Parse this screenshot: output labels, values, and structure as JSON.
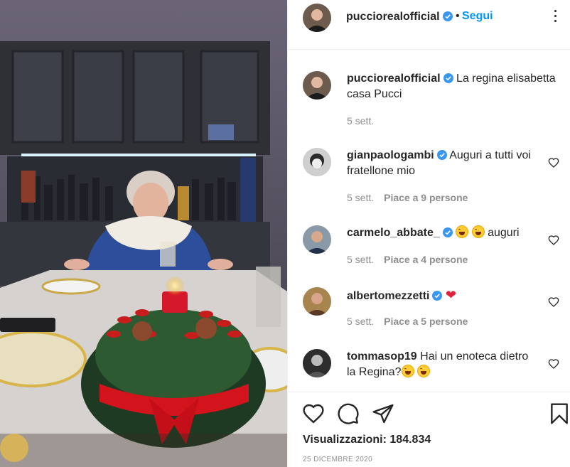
{
  "post": {
    "username": "pucciorealofficial",
    "follow_label": "Segui",
    "separator": "•",
    "caption_user": "pucciorealofficial",
    "caption_text": "La regina elisabetta casa Pucci",
    "caption_time": "5 sett."
  },
  "comments": [
    {
      "user": "gianpaologambi",
      "text": "Auguri a tutti voi fratellone mio",
      "time": "5 sett.",
      "likes": "Piace a 9 persone"
    },
    {
      "user": "carmelo_abbate_",
      "text": " auguri",
      "time": "5 sett.",
      "likes": "Piace a 4 persone"
    },
    {
      "user": "albertomezzetti",
      "text": "",
      "time": "5 sett.",
      "likes": "Piace a 5 persone"
    },
    {
      "user": "tommasop19",
      "text": "Hai un enoteca dietro la Regina?",
      "time": "",
      "likes": ""
    }
  ],
  "footer": {
    "views_label": "Visualizzazioni:",
    "views_count": "184.834",
    "date": "25 DICEMBRE 2020"
  },
  "colors": {
    "link_blue": "#0095f6",
    "verified_blue": "#3897f0",
    "heart_red": "#e0213a",
    "meta_gray": "#8e8e8e"
  },
  "icons": [
    "verified-badge-icon",
    "more-options-icon",
    "like-heart-icon",
    "comment-icon",
    "share-icon",
    "save-bookmark-icon",
    "comment-like-heart-icon"
  ]
}
